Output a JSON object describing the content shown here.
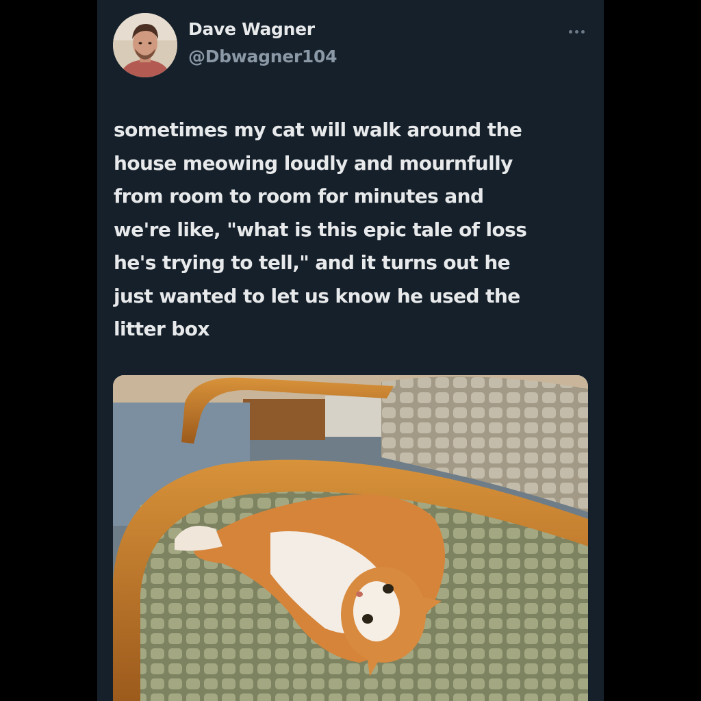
{
  "tweet": {
    "author": {
      "name": "Dave Wagner",
      "handle": "@Dbwagner104"
    },
    "text": "sometimes my cat will walk around the\nhouse meowing loudly and mournfully\nfrom room to room for minutes and\nwe're like, \"what is this epic tale of loss\nhe's trying to tell,\" and it turns out he\njust wanted to let us know he used the\nlitter box",
    "media_icon": "photo-of-orange-white-cat-on-chair"
  },
  "colors": {
    "background": "#000000",
    "card": "#15202b",
    "primary_text": "#e7e9ea",
    "secondary_text": "#8b98a5"
  },
  "icons": {
    "more": "more-horizontal-icon"
  }
}
